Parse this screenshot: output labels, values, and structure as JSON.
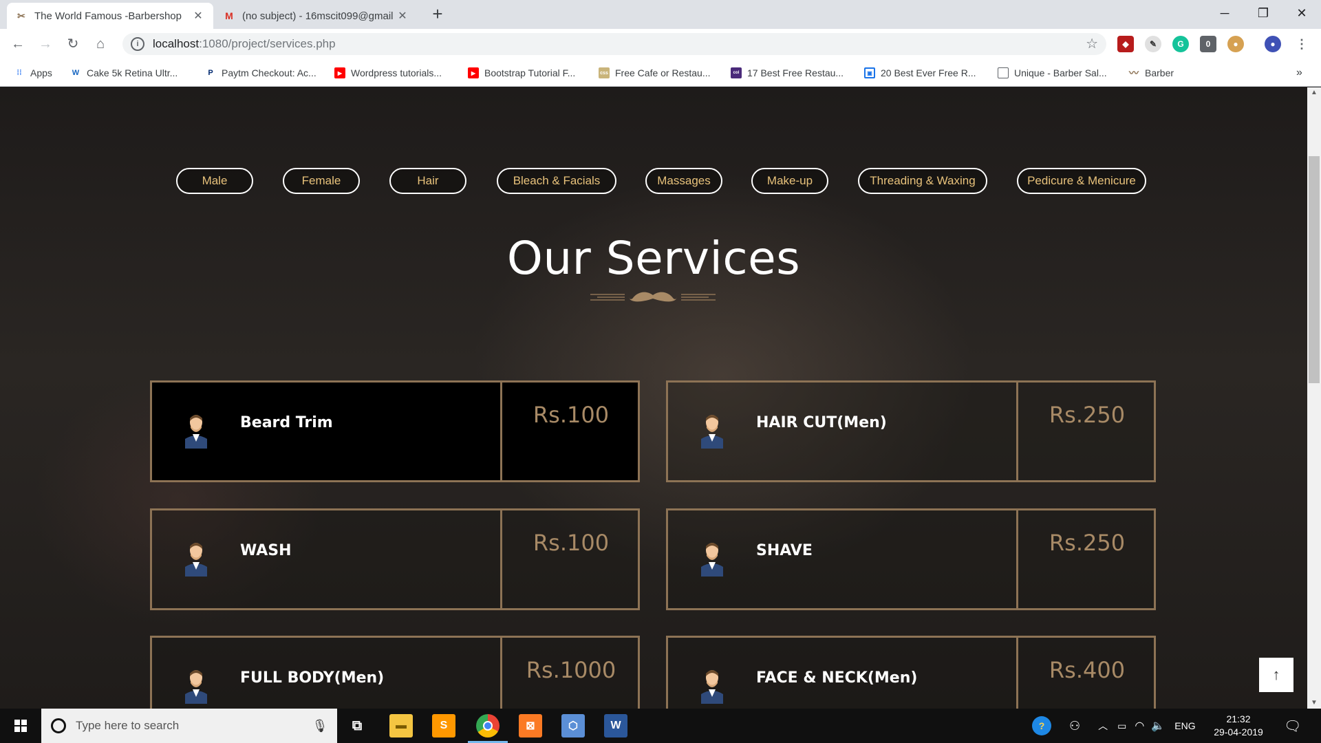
{
  "browser": {
    "tabs": [
      {
        "title": "The World Famous -Barbershop",
        "active": true,
        "favicon": "barber-pole-icon"
      },
      {
        "title": "(no subject) - 16mscit099@gmail",
        "active": false,
        "favicon": "gmail-icon"
      }
    ],
    "new_tab_symbol": "+",
    "url_host": "localhost",
    "url_rest": ":1080/project/services.php",
    "bookmarks": [
      {
        "label": "Apps",
        "icon": "apps-grid-icon",
        "color": "#4285f4"
      },
      {
        "label": "Cake 5k Retina Ultr...",
        "icon": "w-logo-icon",
        "color": "#1565c0"
      },
      {
        "label": "Paytm Checkout: Ac...",
        "icon": "paytm-icon",
        "color": "#002970"
      },
      {
        "label": "Wordpress tutorials...",
        "icon": "youtube-icon",
        "color": "#ff0000"
      },
      {
        "label": "Bootstrap Tutorial F...",
        "icon": "youtube-icon",
        "color": "#ff0000"
      },
      {
        "label": "Free Cafe or Restau...",
        "icon": "css-icon",
        "color": "#c9b47a"
      },
      {
        "label": "17 Best Free Restau...",
        "icon": "colorlib-icon",
        "color": "#4a2a7a"
      },
      {
        "label": "20 Best Ever Free R...",
        "icon": "bookmark-page-icon",
        "color": "#1a73e8"
      },
      {
        "label": "Unique - Barber Sal...",
        "icon": "document-icon",
        "color": "#5f6368"
      },
      {
        "label": "Barber",
        "icon": "mustache-icon",
        "color": "#8d7355"
      }
    ],
    "overflow_symbol": "»"
  },
  "page": {
    "filters": [
      "Male",
      "Female",
      "Hair",
      "Bleach & Facials",
      "Massages",
      "Make-up",
      "Threading & Waxing",
      "Pedicure & Menicure"
    ],
    "heading": "Our Services",
    "services": [
      {
        "name": "Beard Trim",
        "price": "Rs.100"
      },
      {
        "name": "HAIR CUT(Men)",
        "price": "Rs.250"
      },
      {
        "name": "WASH",
        "price": "Rs.100"
      },
      {
        "name": "SHAVE",
        "price": "Rs.250"
      },
      {
        "name": "FULL BODY(Men)",
        "price": "Rs.1000"
      },
      {
        "name": "FACE & NECK(Men)",
        "price": "Rs.400"
      }
    ],
    "to_top_symbol": "↑",
    "colors": {
      "accent_gold": "#e8c27b",
      "border_bronze": "#8d7355",
      "price": "#a88a66"
    }
  },
  "taskbar": {
    "search_placeholder": "Type here to search",
    "apps": [
      "task-view-icon",
      "file-explorer-icon",
      "sublime-text-icon",
      "chrome-icon",
      "xampp-icon",
      "virtualbox-icon",
      "word-icon"
    ],
    "language": "ENG",
    "time": "21:32",
    "date": "29-04-2019"
  }
}
